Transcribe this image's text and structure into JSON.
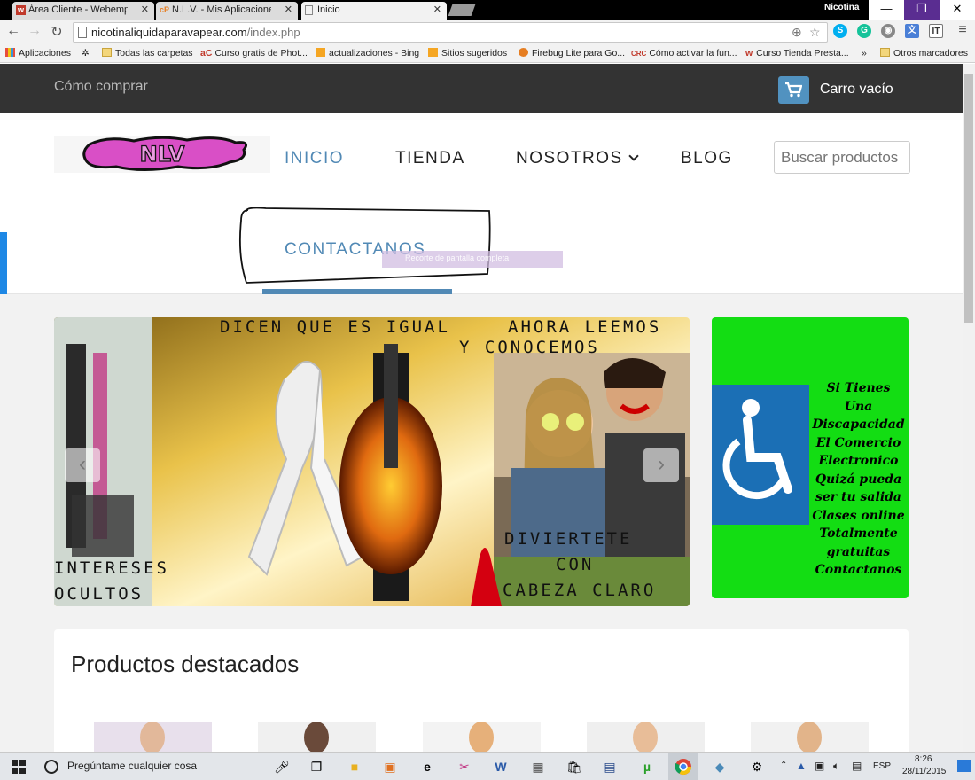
{
  "browser": {
    "tabs": [
      {
        "label": "Área Cliente - Webempre",
        "icon": "webempresa-favicon"
      },
      {
        "label": "N.L.V. - Mis Aplicaciones",
        "icon": "cpanel-favicon"
      },
      {
        "label": "Inicio",
        "icon": "page-favicon"
      }
    ],
    "user": "Nicotina",
    "url_host": "nicotinaliquidaparavapear.com",
    "url_path": "/index.php",
    "bookmarks": [
      {
        "label": "Aplicaciones",
        "icon": "apps-grid-icon"
      },
      {
        "label": "",
        "icon": "gear-icon"
      },
      {
        "label": "Todas las carpetas",
        "icon": "folder-icon"
      },
      {
        "label": "Curso gratis de Phot...",
        "icon": "ac-favicon"
      },
      {
        "label": "actualizaciones - Bing",
        "icon": "bing-favicon"
      },
      {
        "label": "Sitios sugeridos",
        "icon": "bing-favicon"
      },
      {
        "label": "Firebug Lite para Go...",
        "icon": "firebug-favicon"
      },
      {
        "label": "Cómo activar la fun...",
        "icon": "crc-favicon"
      },
      {
        "label": "Curso Tienda Presta...",
        "icon": "webempresa-favicon"
      }
    ],
    "bookmarks_more": "»",
    "other_bookmarks": "Otros marcadores"
  },
  "site": {
    "how_to_buy": "Cómo comprar",
    "cart": "Carro vacío",
    "logo_text": "NLV",
    "nav": {
      "home": "INICIO",
      "shop": "TIENDA",
      "about": "NOSOTROS",
      "blog": "BLOG",
      "contact": "CONTACTANOS"
    },
    "search_placeholder": "Buscar productos",
    "screenshot_tooltip": "Recorte de pantalla completa",
    "slider": {
      "captions": [
        "DICEN  QUE ES  IGUAL",
        "AHORA  LEEMOS",
        "Y CONOCEMOS",
        "INTERESES",
        "OCULTOS",
        "DIVIERTETE",
        "CON",
        "CABEZA  CLARO"
      ],
      "prev": "‹",
      "next": "›"
    },
    "side_banner": {
      "lines": [
        "Si Tienes",
        "Una",
        "Discapacidad",
        "El Comercio",
        "Electronico",
        "Quizá pueda",
        "ser tu salida",
        "Clases online",
        "Totalmente",
        "gratuitas",
        "Contactanos"
      ]
    },
    "featured_title": "Productos destacados"
  },
  "taskbar": {
    "search": "Pregúntame cualquier cosa",
    "lang": "ESP",
    "time": "8:26",
    "date": "28/11/2015"
  },
  "colors": {
    "accent": "#5189b5",
    "topbar": "#333333",
    "side_banner": "#13dd13"
  }
}
